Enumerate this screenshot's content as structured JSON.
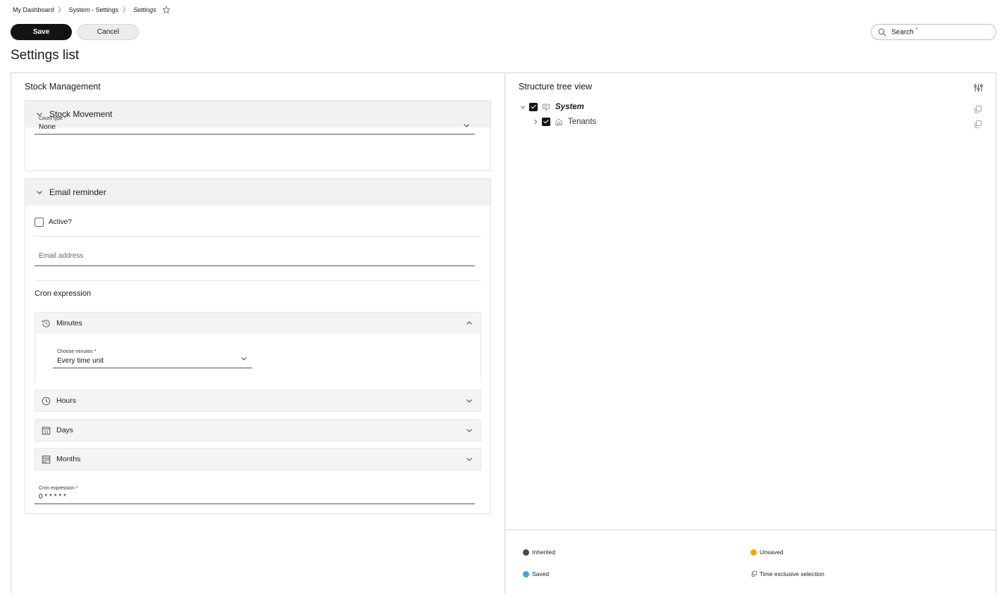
{
  "breadcrumb": {
    "items": [
      "My Dashboard",
      "System - Settings",
      "Settings"
    ]
  },
  "toolbar": {
    "save_label": "Save",
    "cancel_label": "Cancel",
    "search_label": "Search",
    "search_required": "*"
  },
  "page": {
    "title": "Settings list"
  },
  "left": {
    "section_title": "Stock Management",
    "stock_movement": {
      "title": "Stock Movement",
      "count_type_label": "Count type",
      "count_type_required": "*",
      "count_type_value": "None"
    },
    "email_reminder": {
      "title": "Email reminder",
      "active_label": "Active?",
      "email_placeholder": "Email address",
      "cron_title": "Cron expression",
      "minutes": {
        "title": "Minutes",
        "choose_label": "Choose minutes",
        "choose_required": "*",
        "choose_value": "Every time unit"
      },
      "hours_title": "Hours",
      "days_title": "Days",
      "days_icon_text": "31",
      "months_title": "Months",
      "cron_field_label": "Cron expression",
      "cron_field_required": "*",
      "cron_field_value": "0 * * * * *"
    }
  },
  "right": {
    "title": "Structure tree view",
    "tree": {
      "system_label": "System",
      "tenants_label": "Tenants"
    },
    "legend": {
      "inherited": "Inherited",
      "unsaved": "Unsaved",
      "saved": "Saved",
      "time_exclusive": "Time exclusive selection"
    }
  },
  "colors": {
    "inherited": "#3d4a5c",
    "unsaved": "#f5a800",
    "saved": "#3aa3e3"
  }
}
